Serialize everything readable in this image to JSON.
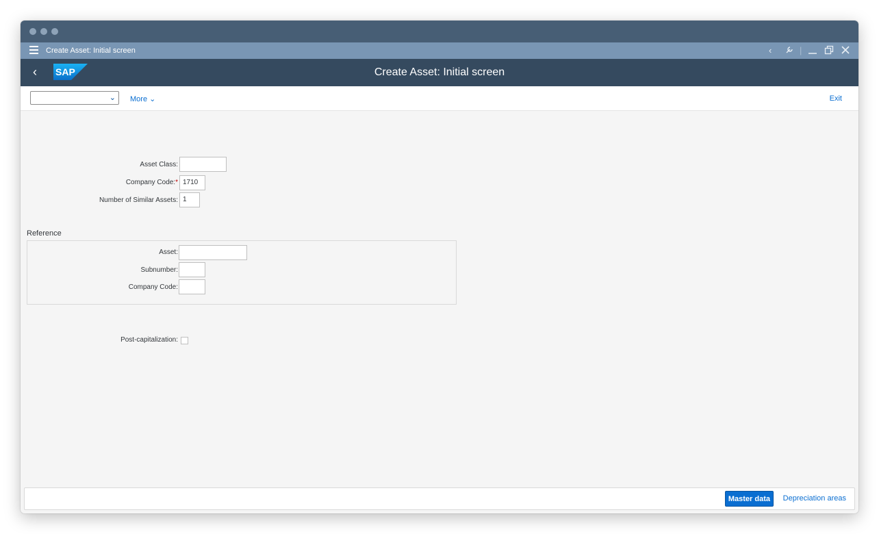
{
  "window": {
    "gui_title": "Create Asset: Initial screen"
  },
  "shell": {
    "logo_text": "SAP",
    "title": "Create Asset: Initial screen"
  },
  "toolbar": {
    "select_value": "",
    "more_label": "More",
    "exit_label": "Exit"
  },
  "form": {
    "asset_class": {
      "label": "Asset Class:",
      "value": ""
    },
    "company_code": {
      "label": "Company Code:",
      "required": "*",
      "value": "1710"
    },
    "similar_assets": {
      "label": "Number of Similar Assets:",
      "value": "1"
    }
  },
  "reference": {
    "title": "Reference",
    "asset": {
      "label": "Asset:",
      "value": ""
    },
    "subnumber": {
      "label": "Subnumber:",
      "value": ""
    },
    "company_code": {
      "label": "Company Code:",
      "value": ""
    }
  },
  "post_cap": {
    "label": "Post-capitalization:",
    "checked": false
  },
  "footer": {
    "master_data_label": "Master data",
    "depreciation_label": "Depreciation areas"
  },
  "colors": {
    "shell_bg": "#354a5f",
    "gui_bar_bg": "#7996b4",
    "accent": "#0a6ed1",
    "required": "#bb0000"
  },
  "icons": [
    "menu-icon",
    "back-icon",
    "sap-logo",
    "chevron-down-icon",
    "collapse-icon",
    "customize-icon",
    "minimize-icon",
    "restore-icon",
    "close-icon"
  ]
}
